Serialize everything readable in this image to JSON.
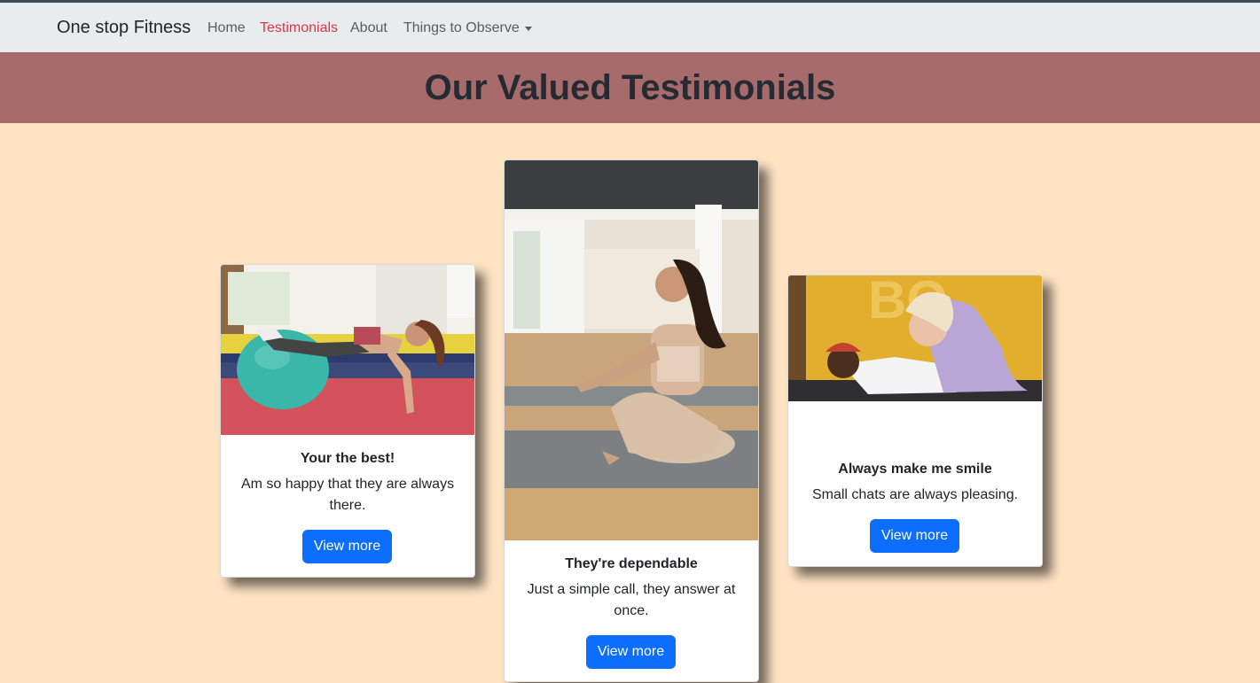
{
  "navbar": {
    "brand": "One stop Fitness",
    "links": [
      {
        "label": "Home"
      },
      {
        "label": "Testimonials"
      },
      {
        "label": "About"
      },
      {
        "label": "Things to Observe"
      }
    ],
    "active_color": "#dc3545"
  },
  "hero": {
    "title": "Our Valued Testimonials",
    "background": "#a76b6b"
  },
  "page": {
    "background": "#ffe4c4"
  },
  "cards": [
    {
      "title": "Your the best!",
      "text": "Am so happy that they are always there.",
      "button": "View more",
      "image": "woman doing push-up on exercise ball"
    },
    {
      "title": "They're dependable",
      "text": "Just a simple call, they answer at once.",
      "button": "View more",
      "image": "woman meditating on yoga mat"
    },
    {
      "title": "Always make me smile",
      "text": "Small chats are always pleasing.",
      "button": "View more",
      "image": "two people doing plank exercise"
    }
  ],
  "button_color": "#0d6efd"
}
